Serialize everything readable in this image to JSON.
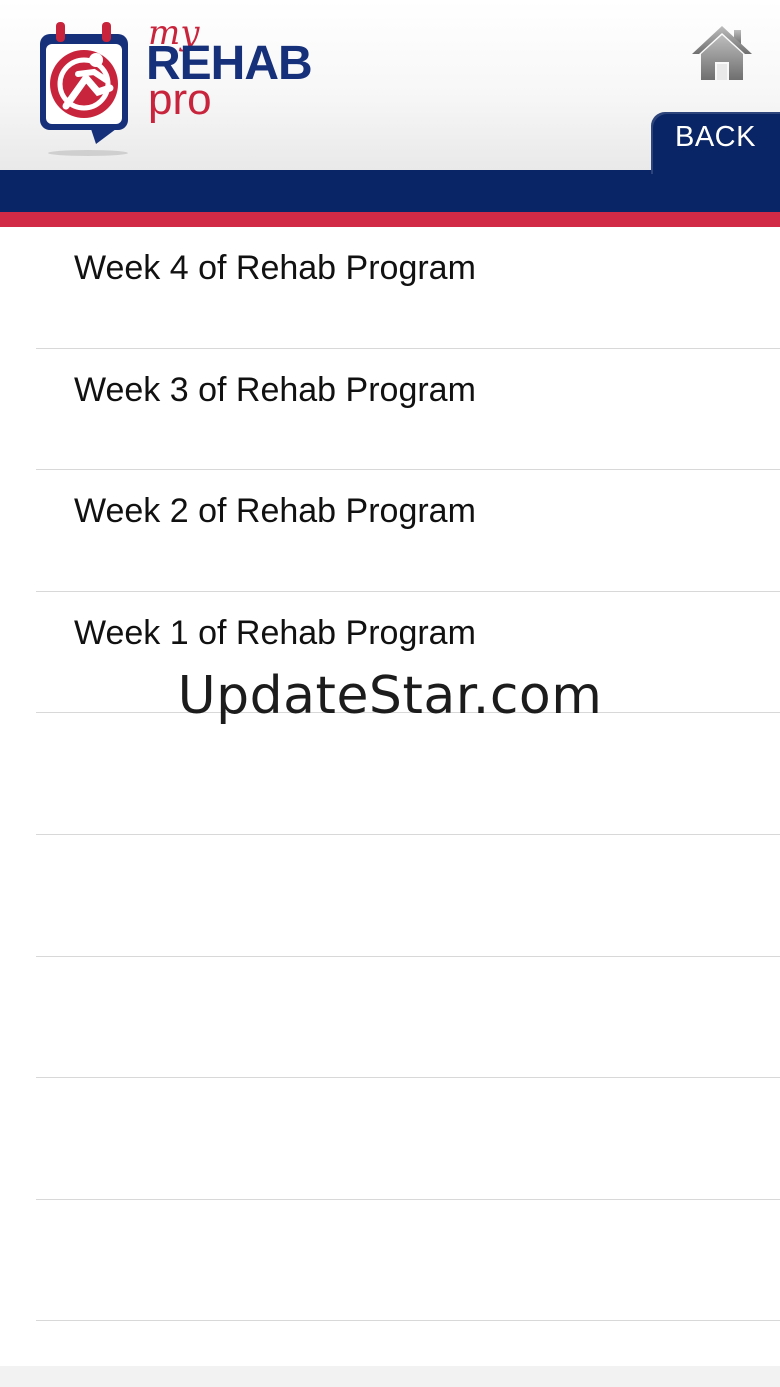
{
  "header": {
    "logo": {
      "word_my": "my",
      "word_rehab": "REHAB",
      "word_pro": "pro"
    },
    "home_icon": "home-icon",
    "back_label": "BACK"
  },
  "colors": {
    "navy": "#0a2566",
    "red": "#d02a47"
  },
  "weeks": [
    {
      "label": "Week 4 of Rehab Program"
    },
    {
      "label": "Week 3 of Rehab Program"
    },
    {
      "label": "Week 2 of Rehab Program"
    },
    {
      "label": "Week 1 of Rehab Program"
    },
    {
      "label": ""
    },
    {
      "label": ""
    },
    {
      "label": ""
    },
    {
      "label": ""
    },
    {
      "label": ""
    }
  ],
  "watermark": "UpdateStar.com"
}
